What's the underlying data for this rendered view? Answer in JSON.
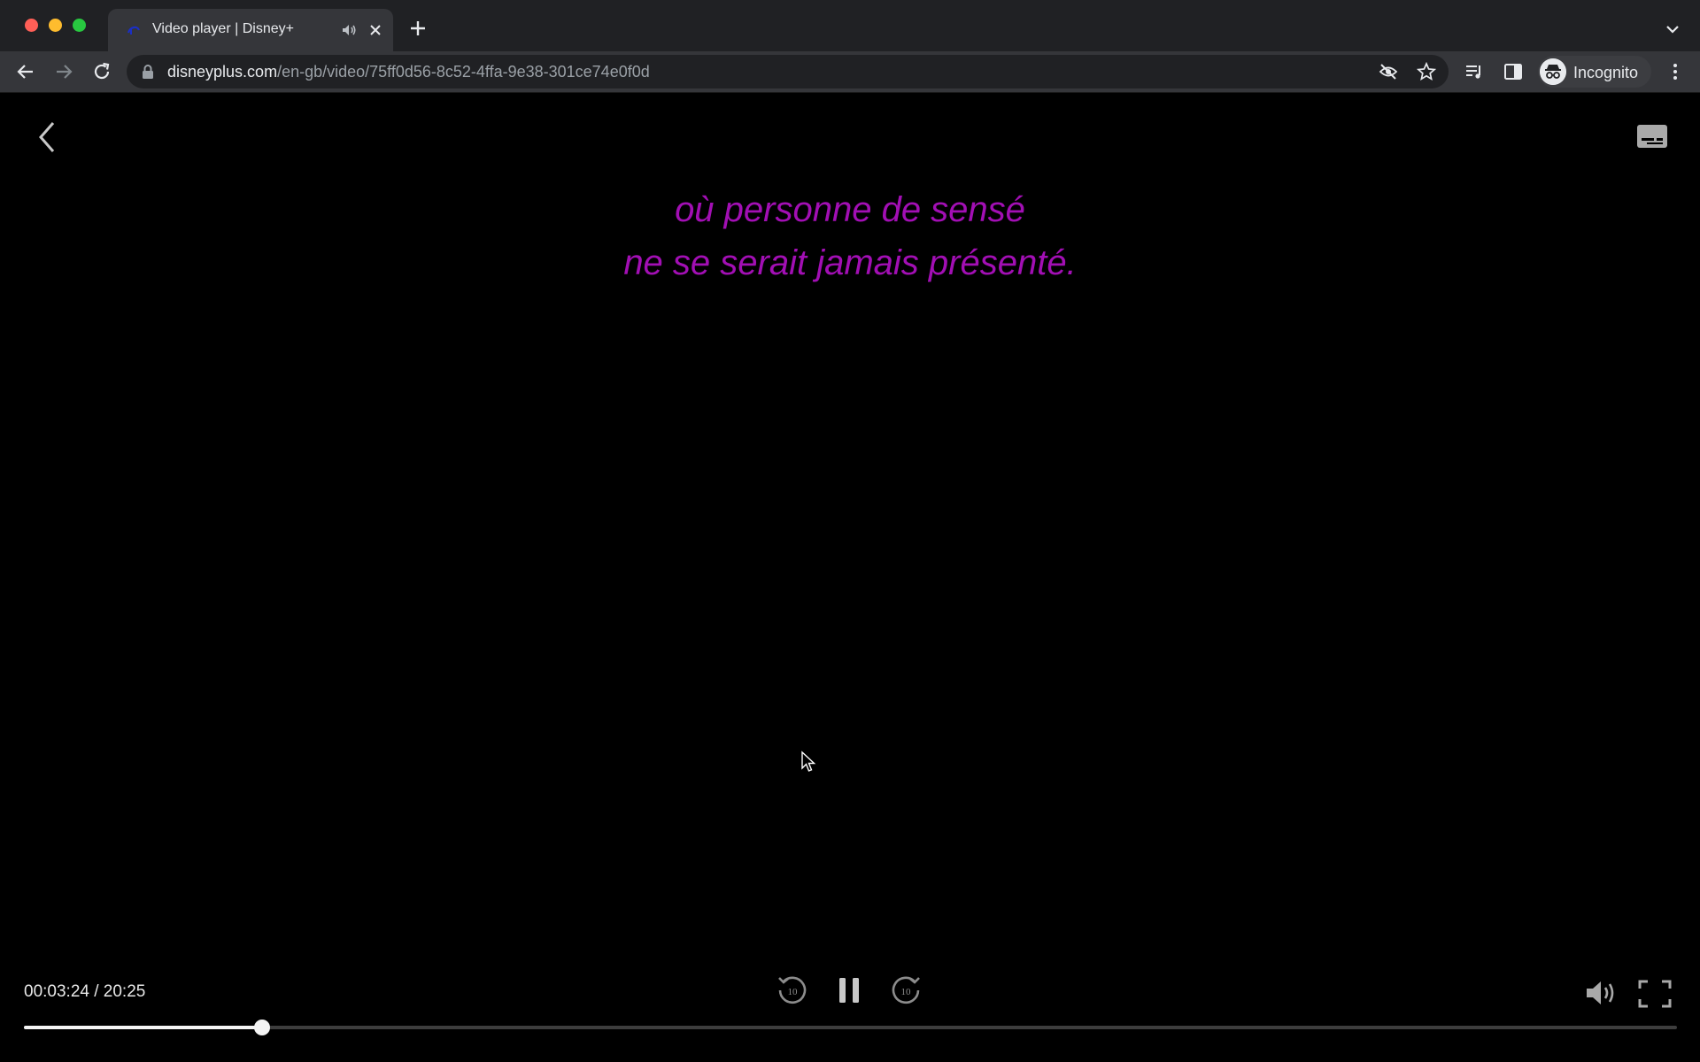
{
  "browser": {
    "tab": {
      "title": "Video player | Disney+"
    },
    "address_bar": {
      "host": "disneyplus.com",
      "path": "/en-gb/video/75ff0d56-8c52-4ffa-9e38-301ce74e0f0d"
    },
    "profile": {
      "label": "Incognito"
    },
    "icons": {
      "tab_favicon": "disney-plus-icon",
      "tab_audio": "speaker-icon",
      "tab_close": "close-icon",
      "new_tab": "plus-icon",
      "tab_list": "chevron-down-icon",
      "back": "arrow-left-icon",
      "forward": "arrow-right-icon",
      "reload": "reload-icon",
      "lock": "lock-icon",
      "tracking": "eye-off-icon",
      "bookmark": "star-icon",
      "media": "media-queue-icon",
      "side_panel": "side-panel-icon",
      "menu": "kebab-menu-icon"
    }
  },
  "player": {
    "subtitles": {
      "line1": "où personne de sensé",
      "line2": "ne se serait jamais présenté.",
      "color": "#a20fb4"
    },
    "time": {
      "display": "00:03:24 / 20:25",
      "progress": 0.144
    },
    "controls": {
      "rewind_seconds": "10",
      "forward_seconds": "10",
      "icons": {
        "back": "chevron-left-icon",
        "captions": "captions-icon",
        "rewind": "rewind-10-icon",
        "pause": "pause-icon",
        "forward": "forward-10-icon",
        "volume": "volume-icon",
        "fullscreen": "fullscreen-icon"
      }
    }
  }
}
